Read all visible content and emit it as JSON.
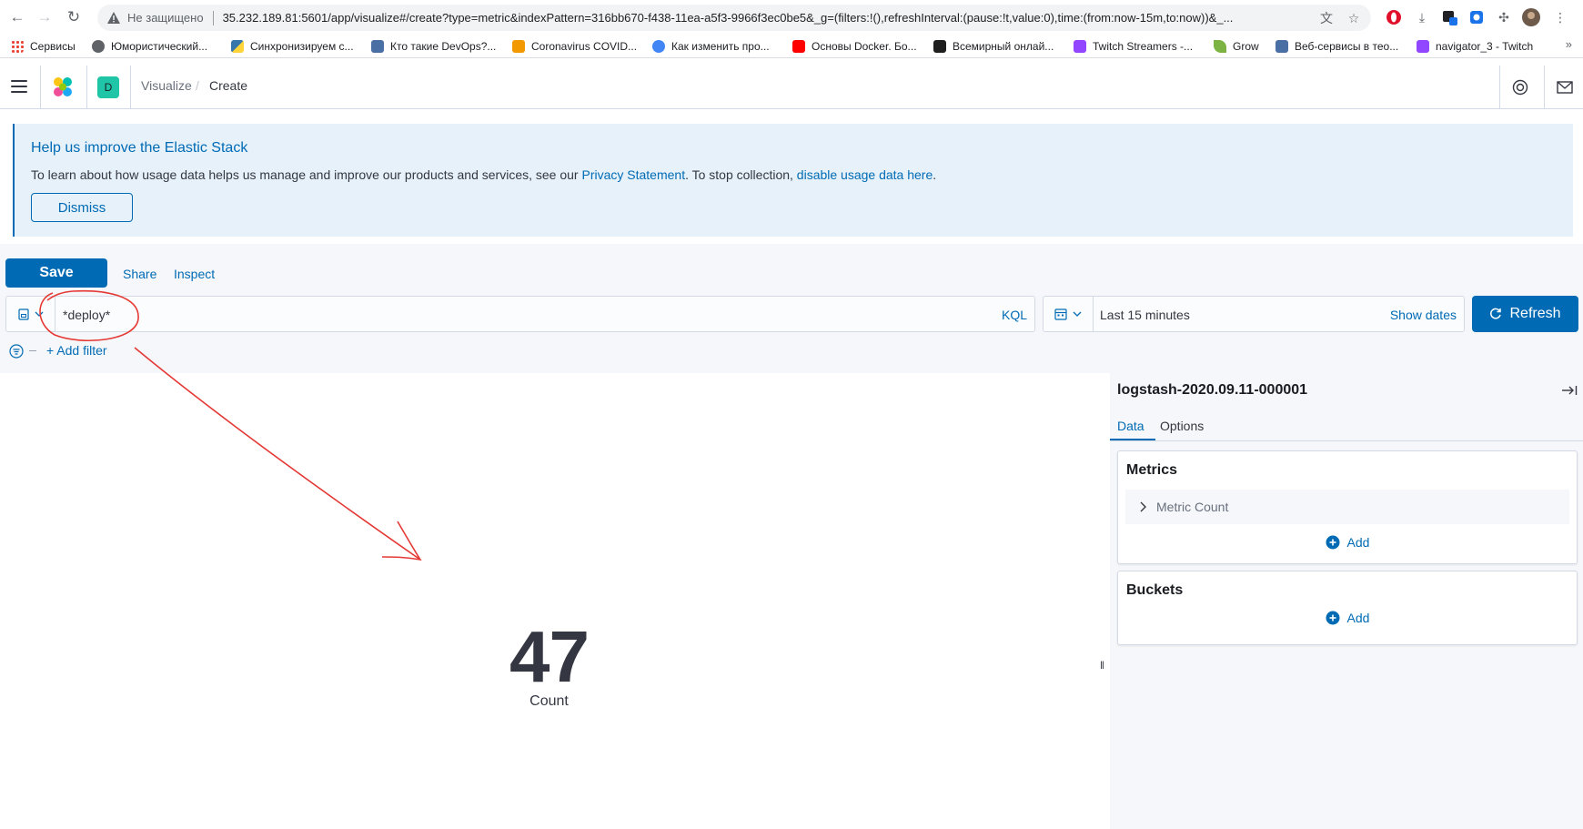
{
  "browser": {
    "insecure_label": "Не защищено",
    "url": "35.232.189.81:5601/app/visualize#/create?type=metric&indexPattern=316bb670-f438-11ea-a5f3-9966f3ec0be5&_g=(filters:!(),refreshInterval:(pause:!t,value:0),time:(from:now-15m,to:now))&_...",
    "bookmarks": [
      {
        "label": "Сервисы",
        "icon": "apps-grid-icon",
        "color": "#ea4335"
      },
      {
        "label": "Юмористический...",
        "icon": "globe-icon",
        "color": "#5f6368"
      },
      {
        "label": "Синхронизируем с...",
        "icon": "python-icon",
        "color": "#3776ab"
      },
      {
        "label": "Кто такие DevOps?...",
        "icon": "puzzle-icon",
        "color": "#4a6fa5"
      },
      {
        "label": "Coronavirus COVID...",
        "icon": "rss-icon",
        "color": "#f29900"
      },
      {
        "label": "Как изменить про...",
        "icon": "github-icon",
        "color": "#4285f4"
      },
      {
        "label": "Основы Docker. Бо...",
        "icon": "youtube-icon",
        "color": "#ff0000"
      },
      {
        "label": "Всемирный онлай...",
        "icon": "beer-icon",
        "color": "#1f1f1f"
      },
      {
        "label": "Twitch Streamers -...",
        "icon": "twitch-icon",
        "color": "#9146ff"
      },
      {
        "label": "Grow",
        "icon": "leaf-icon",
        "color": "#7cb342"
      },
      {
        "label": "Веб-сервисы в тео...",
        "icon": "puzzle-icon",
        "color": "#4a6fa5"
      },
      {
        "label": "navigator_3 - Twitch",
        "icon": "twitch-icon",
        "color": "#9146ff"
      }
    ],
    "bookmarks_more": "»"
  },
  "header": {
    "space_initial": "D",
    "breadcrumb_1": "Visualize",
    "breadcrumb_sep": "/",
    "breadcrumb_2": "Create"
  },
  "callout": {
    "title": "Help us improve the Elastic Stack",
    "text_1": "To learn about how usage data helps us manage and improve our products and services, see our ",
    "link_1": "Privacy Statement",
    "text_2": ". To stop collection, ",
    "link_2": "disable usage data here",
    "text_3": ".",
    "dismiss_label": "Dismiss"
  },
  "top_nav": {
    "save_label": "Save",
    "share_label": "Share",
    "inspect_label": "Inspect"
  },
  "query": {
    "value": "*deploy*",
    "language": "KQL",
    "time_range": "Last 15 minutes",
    "show_dates_label": "Show dates",
    "refresh_label": "Refresh",
    "add_filter_label": "+ Add filter"
  },
  "visualization": {
    "metric_value": "47",
    "metric_label": "Count"
  },
  "sidebar": {
    "index_pattern": "logstash-2020.09.11-000001",
    "tabs": [
      {
        "label": "Data",
        "active": true
      },
      {
        "label": "Options",
        "active": false
      }
    ],
    "metrics_title": "Metrics",
    "metric_item": "Metric Count",
    "metrics_add": "Add",
    "buckets_title": "Buckets",
    "buckets_add": "Add"
  },
  "colors": {
    "primary": "#006bb4",
    "callout_bg": "#e6f1fa",
    "annotation": "#e53935",
    "space_badge": "#20c5a8"
  }
}
